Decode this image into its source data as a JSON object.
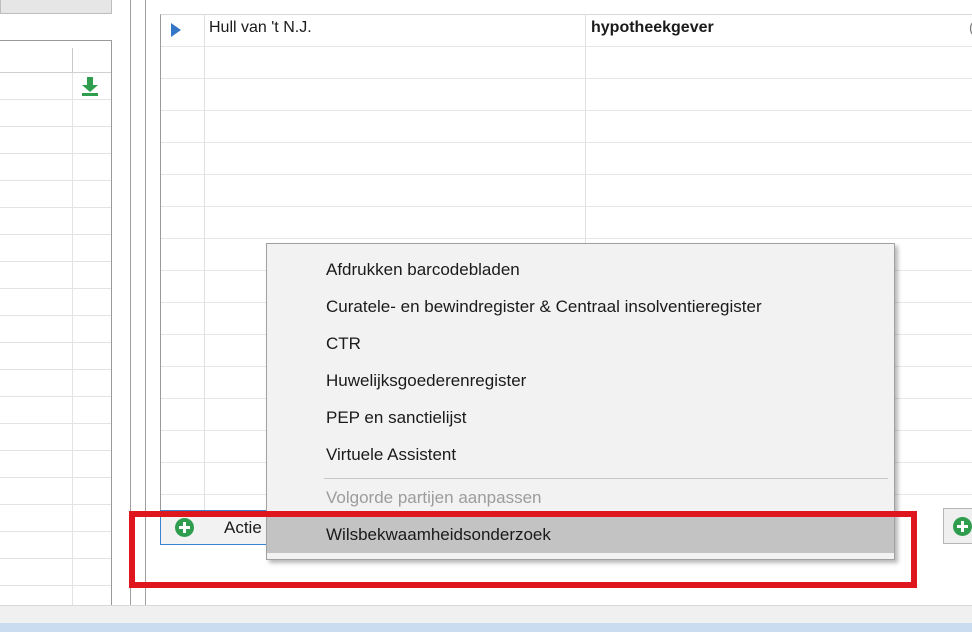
{
  "grid": {
    "rows": [
      {
        "name": "Hull van 't N.J.",
        "role": "hypotheekgever",
        "extra": "("
      },
      {
        "name": "",
        "role": "",
        "extra": ""
      },
      {
        "name": "",
        "role": "",
        "extra": ""
      },
      {
        "name": "",
        "role": "",
        "extra": ""
      },
      {
        "name": "",
        "role": "",
        "extra": ""
      },
      {
        "name": "",
        "role": "",
        "extra": ""
      },
      {
        "name": "",
        "role": "",
        "extra": ""
      },
      {
        "name": "",
        "role": "",
        "extra": ""
      },
      {
        "name": "",
        "role": "",
        "extra": ""
      },
      {
        "name": "",
        "role": "",
        "extra": ""
      },
      {
        "name": "",
        "role": "",
        "extra": ""
      },
      {
        "name": "",
        "role": "",
        "extra": ""
      },
      {
        "name": "",
        "role": "",
        "extra": ""
      },
      {
        "name": "",
        "role": "",
        "extra": ""
      },
      {
        "name": "",
        "role": "",
        "extra": ""
      },
      {
        "name": "",
        "role": "",
        "extra": ""
      }
    ]
  },
  "left_pane": {
    "row_count": 21
  },
  "actions": {
    "actie_label": "Actie"
  },
  "context_menu": {
    "items": [
      {
        "label": "Afdrukken barcodebladen",
        "enabled": true,
        "highlighted": false
      },
      {
        "label": "Curatele- en bewindregister & Centraal insolventieregister",
        "enabled": true,
        "highlighted": false
      },
      {
        "label": "CTR",
        "enabled": true,
        "highlighted": false
      },
      {
        "label": "Huwelijksgoederenregister",
        "enabled": true,
        "highlighted": false
      },
      {
        "label": "PEP en sanctielijst",
        "enabled": true,
        "highlighted": false
      },
      {
        "label": "Virtuele Assistent",
        "enabled": true,
        "highlighted": false
      },
      {
        "label": "Volgorde partijen aanpassen",
        "enabled": false,
        "highlighted": false
      },
      {
        "label": "Wilsbekwaamheidsonderzoek",
        "enabled": true,
        "highlighted": true
      }
    ],
    "separator_after_index": 5
  },
  "colors": {
    "accent": "#3a83d1",
    "row_pointer": "#3577c6",
    "add_icon": "#2f9d4e",
    "download_icon": "#2f9d4e",
    "annotation": "#e0161f",
    "menu_highlight": "#c3c3c3"
  },
  "icons": {
    "row_pointer": "triangle-right-icon",
    "download": "download-arrow-icon",
    "add": "plus-circle-icon"
  }
}
